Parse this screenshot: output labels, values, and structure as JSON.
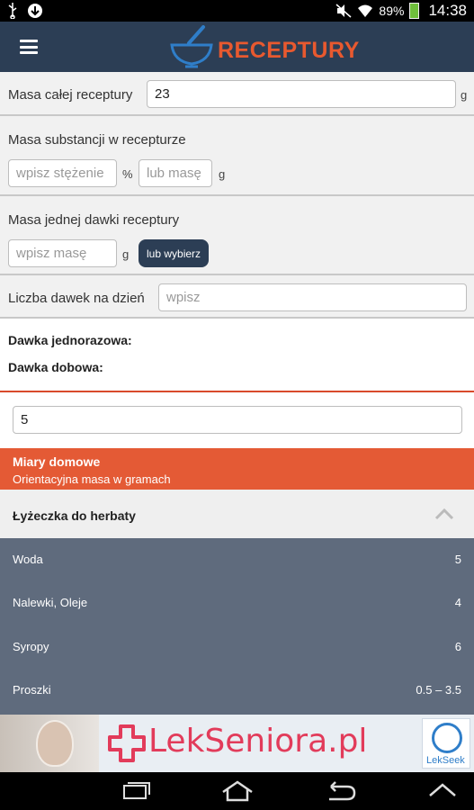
{
  "status_bar": {
    "battery": "89%",
    "time": "14:38",
    "icons": [
      "usb-icon",
      "download-icon",
      "mute-icon",
      "wifi-icon",
      "battery-icon"
    ]
  },
  "app": {
    "title": "RECEPTURY",
    "menu_icon": "hamburger-icon",
    "brand_color": "#e8592f",
    "header_color": "#2c3e55"
  },
  "form": {
    "total_mass_label": "Masa całej receptury",
    "total_mass_value": "23",
    "total_mass_unit": "g",
    "substance_label": "Masa substancji w recepturze",
    "concentration_placeholder": "wpisz stężenie",
    "percent_unit": "%",
    "substance_mass_placeholder": "lub masę",
    "substance_unit": "g",
    "dose_label": "Masa jednej dawki receptury",
    "dose_placeholder": "wpisz masę",
    "dose_unit": "g",
    "choose_button": "lub wybierz",
    "doses_per_day_label": "Liczba dawek na dzień",
    "doses_per_day_placeholder": "wpisz"
  },
  "results": {
    "single_dose_label": "Dawka jednorazowa:",
    "daily_dose_label": "Dawka dobowa:"
  },
  "quantity_value": "5",
  "household": {
    "title": "Miary domowe",
    "subtitle": "Orientacyjna masa w gramach",
    "accent": "#e45a35"
  },
  "accordion": {
    "title": "Łyżeczka do herbaty",
    "icon": "chevron-up-icon"
  },
  "table": {
    "rows": [
      {
        "name": "Woda",
        "value": "5"
      },
      {
        "name": "Nalewki, Oleje",
        "value": "4"
      },
      {
        "name": "Syropy",
        "value": "6"
      },
      {
        "name": "Proszki",
        "value": "0.5 – 3.5"
      }
    ]
  },
  "ad": {
    "text": "LekSeniora.pl",
    "badge": "LekSeek"
  },
  "nav": {
    "icons": [
      "recent-apps-icon",
      "home-icon",
      "back-icon",
      "up-icon"
    ]
  }
}
